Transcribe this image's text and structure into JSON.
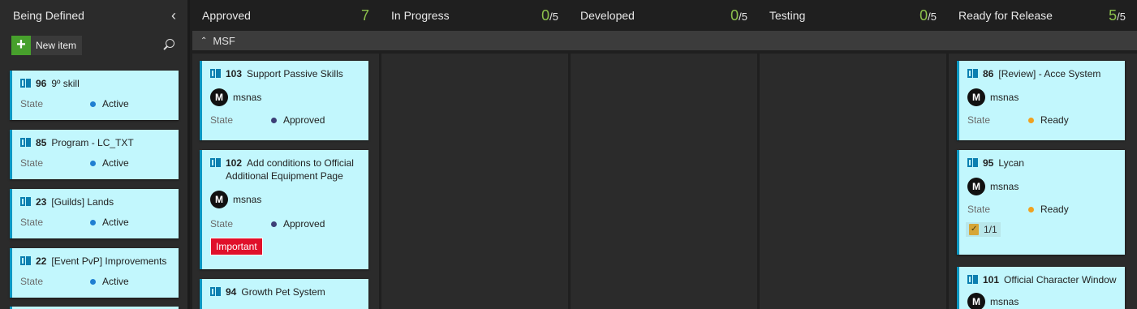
{
  "columns": {
    "being_defined": {
      "title": "Being Defined",
      "new_item": "New item"
    },
    "approved": {
      "title": "Approved",
      "count": "7"
    },
    "in_progress": {
      "title": "In Progress",
      "count": "0",
      "limit": "/5"
    },
    "developed": {
      "title": "Developed",
      "count": "0",
      "limit": "/5"
    },
    "testing": {
      "title": "Testing",
      "count": "0",
      "limit": "/5"
    },
    "ready": {
      "title": "Ready for Release",
      "count": "5",
      "limit": "/5"
    }
  },
  "swimlane": {
    "label": "MSF"
  },
  "state_label": "State",
  "defined_cards": [
    {
      "id": "96",
      "title": "9º skill",
      "state": "Active"
    },
    {
      "id": "85",
      "title": "Program - LC_TXT",
      "state": "Active"
    },
    {
      "id": "23",
      "title": "[Guilds] Lands",
      "state": "Active"
    },
    {
      "id": "22",
      "title": "[Event PvP] Improvements",
      "state": "Active"
    }
  ],
  "approved_cards": [
    {
      "id": "103",
      "title": "Support Passive Skills",
      "user": "msnas",
      "avatar": "M",
      "state": "Approved"
    },
    {
      "id": "102",
      "title": "Add conditions to Official Additional Equipment Page",
      "user": "msnas",
      "avatar": "M",
      "state": "Approved",
      "tag": "Important"
    },
    {
      "id": "94",
      "title": "Growth Pet System"
    }
  ],
  "ready_cards": [
    {
      "id": "86",
      "title": "[Review] - Acce System",
      "user": "msnas",
      "avatar": "M",
      "state": "Ready"
    },
    {
      "id": "95",
      "title": "Lycan",
      "user": "msnas",
      "avatar": "M",
      "state": "Ready",
      "checklist": "1/1"
    },
    {
      "id": "101",
      "title": "Official Character Window",
      "user": "msnas",
      "avatar": "M"
    }
  ],
  "colors": {
    "active": "#1f7fd1",
    "approved": "#3d3f77",
    "ready": "#f0a11f",
    "count": "#8cc14c",
    "card_bg": "#c2f7fd",
    "card_border": "#0c97c2",
    "tag": "#e0102a"
  }
}
